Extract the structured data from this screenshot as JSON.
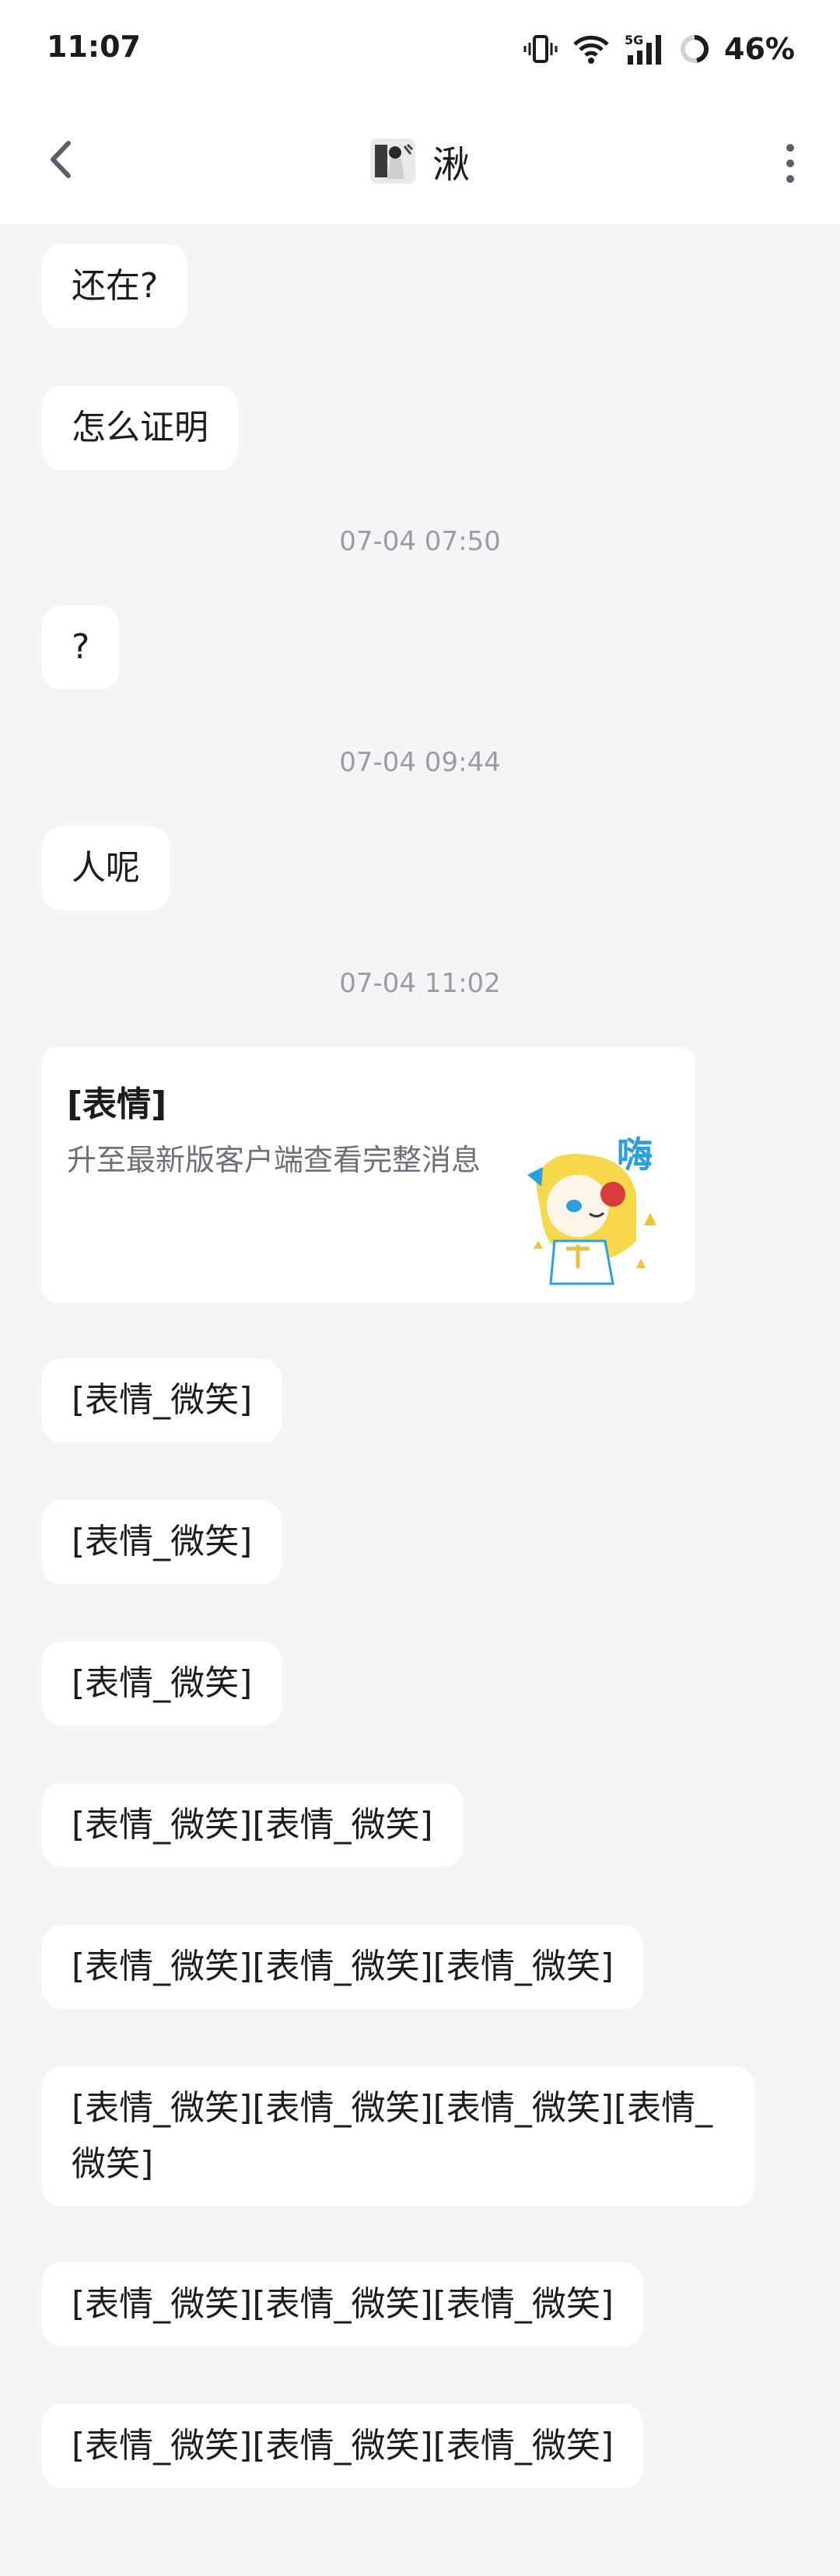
{
  "status_bar": {
    "time": "11:07",
    "network": "5G",
    "battery": "46%"
  },
  "header": {
    "title": "湫",
    "back_icon": "chevron-left-icon",
    "more_icon": "more-vertical-icon"
  },
  "messages": [
    {
      "type": "text",
      "text": "还在?"
    },
    {
      "type": "text",
      "text": "怎么证明"
    },
    {
      "type": "time",
      "text": "07-04 07:50"
    },
    {
      "type": "text",
      "text": "?"
    },
    {
      "type": "time",
      "text": "07-04 09:44"
    },
    {
      "type": "text",
      "text": "人呢"
    },
    {
      "type": "time",
      "text": "07-04 11:02"
    },
    {
      "type": "card",
      "title": "[表情]",
      "desc": "升至最新版客户端查看完整消息",
      "sticker_text": "嗨"
    },
    {
      "type": "text",
      "text": "[表情_微笑]"
    },
    {
      "type": "text",
      "text": "[表情_微笑]"
    },
    {
      "type": "text",
      "text": "[表情_微笑]"
    },
    {
      "type": "text",
      "text": "[表情_微笑][表情_微笑]"
    },
    {
      "type": "text",
      "text": "[表情_微笑][表情_微笑][表情_微笑]"
    },
    {
      "type": "text",
      "text": "[表情_微笑][表情_微笑][表情_微笑][表情_微笑]"
    },
    {
      "type": "text",
      "text": "[表情_微笑][表情_微笑][表情_微笑]"
    },
    {
      "type": "text",
      "text": "[表情_微笑][表情_微笑][表情_微笑]"
    }
  ],
  "colors": {
    "background": "#f4f5f7",
    "bubble": "#ffffff",
    "timestamp": "#9a9ca3"
  }
}
